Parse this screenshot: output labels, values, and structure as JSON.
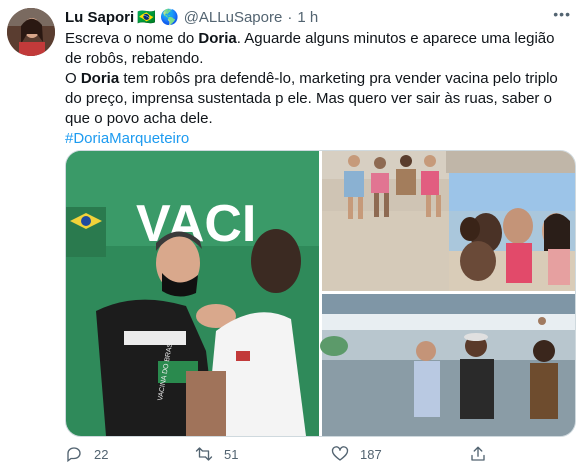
{
  "tweet": {
    "author_name": "Lu Sapori",
    "author_flags": "🇧🇷 🌎",
    "handle": "@ALLuSapore",
    "separator": "·",
    "time": "1 h",
    "more_label": "•••",
    "paragraph1_before": "Escreva o nome do ",
    "paragraph1_bold": "Doria",
    "paragraph1_after": ". Aguarde alguns minutos e aparece uma legião de robôs, rebatendo.",
    "paragraph2_before": "O ",
    "paragraph2_bold": "Doria",
    "paragraph2_after": " tem robôs pra defendê-lo, marketing pra vender vacina pelo triplo do preço, imprensa sustentada p ele. Mas quero ver sair às ruas, saber o que o povo acha dele.",
    "hashtag": "#DoriaMarqueteiro"
  },
  "media": {
    "photo1_sign_text": "VACI",
    "photo1_shirt_text": "VACINA DO BRASIL",
    "icons": [
      "reply-icon",
      "retweet-icon",
      "like-icon",
      "share-icon"
    ]
  },
  "actions": {
    "replies": "22",
    "retweets": "51",
    "likes": "187"
  }
}
